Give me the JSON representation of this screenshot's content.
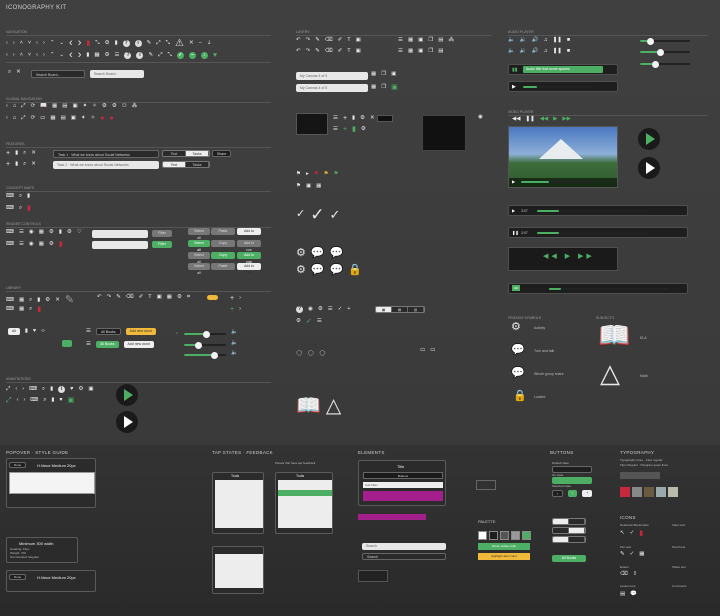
{
  "page": {
    "title": "ICONOGRAPHY KIT"
  },
  "sections": {
    "glyphs_top": "NAVIGATION",
    "search_label": "Search Board...",
    "global": "GLOBAL NAVIGATION",
    "features": "FEATURES",
    "headers": "CONCEPT MAPS",
    "reader": "READER CONTROLS",
    "library": "LIBRARY",
    "annotations": "ANNOTATIONS",
    "layers": "LAYERS",
    "popover_style": "POPOVER · STYLE GUIDE",
    "tap_states": "TAP STATES · FEEDBACK",
    "elements": "ELEMENTS",
    "buttons": "BUTTONS",
    "typography": "TYPOGRAPHY",
    "palette": "PALETTE",
    "icons": "ICONS",
    "audio_player": "AUDIO PLAYER",
    "video_player": "VIDEO PLAYER",
    "friends": "FRIENDS SYMBOLS",
    "subjects": "SUBJECTS"
  },
  "search": {
    "placeholder_1": "Search Board...",
    "placeholder_2": "Search Board..."
  },
  "tasks": {
    "task1": "Task 1 · What we know about Social Networks",
    "task2": "Task 2 · What we know about Social Networks"
  },
  "canvas": {
    "c1": "My Canvas 4 of 5",
    "c2": "My Canvas 4 of 5"
  },
  "seg_labels": {
    "a": "Text",
    "b": "Tasks",
    "c": "Share",
    "d": "Tools"
  },
  "reader_buttons": {
    "filter": "Filter",
    "select_all": "Select all",
    "copy": "Copy",
    "add_to_row": "Add to row",
    "paste": "Paste"
  },
  "library_buttons": {
    "all_books": "All Books",
    "add_new": "Add new word",
    "all": "All"
  },
  "audio": {
    "track": "Audio title that some spaces",
    "t1": "0:06",
    "t2": "-0:35"
  },
  "video": {
    "t1": "3:07",
    "t2": "-8:11",
    "hd": "HD"
  },
  "friends": {
    "activity": "Activity",
    "turn": "Turn and talk",
    "whole": "Whole group share",
    "locked": "Locked"
  },
  "subjects": {
    "ela": "ELA",
    "math": "Math"
  },
  "popover": {
    "heading": "H.Neue Medium 20px",
    "meta": "Heading: 12px\nWeight: 700\nText blocked: Regular",
    "min_width": "Minimum 300 width",
    "heading2": "H.Neue Medium 20px",
    "btn_label": "Done"
  },
  "tap": {
    "title1": "Tools",
    "title2": "Tools",
    "caption": "Panels that have tap feedback"
  },
  "elements": {
    "title": "Title",
    "buttons": "Buttons",
    "sub": "Sub Filter",
    "search": "Search"
  },
  "btn_styles": {
    "default": "Default state",
    "on_state": "On state",
    "selected": "Selected state",
    "all_btn": "All Books"
  },
  "palette": {
    "c_green": "#4caf64",
    "c_yellow": "#f0b93a",
    "c_magenta": "#a31f8c",
    "c_dark": "#1e1e1e",
    "green_label": "Green active color",
    "yellow_label": "Highlight alert color"
  },
  "typo": {
    "t1": "Typography rules · 13px regular",
    "t2": "15px Regular · Pangram quote lines"
  },
  "icons_labels": {
    "a": "Notebook Bookmarks",
    "b": "Index tool",
    "c": "Pen tool",
    "d": "Scroll tool",
    "e": "Eraser",
    "f": "Share tool",
    "g": "Lesson tool",
    "h": "Comments"
  }
}
